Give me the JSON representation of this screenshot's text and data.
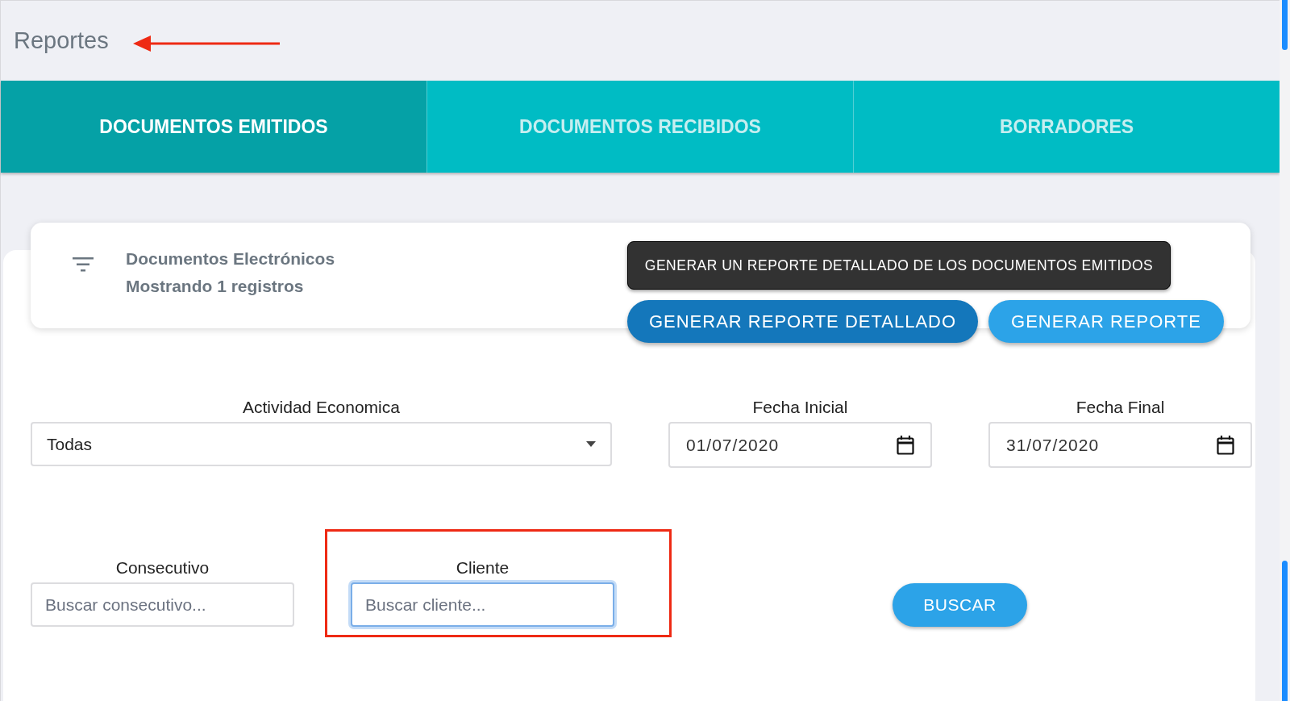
{
  "page_title": "Reportes",
  "tabs": [
    {
      "label": "DOCUMENTOS EMITIDOS",
      "selected": true
    },
    {
      "label": "DOCUMENTOS RECIBIDOS",
      "selected": false
    },
    {
      "label": "BORRADORES",
      "selected": false
    }
  ],
  "summary_card": {
    "title": "Documentos Electrónicos",
    "subtitle": "Mostrando 1 registros"
  },
  "tooltip": "GENERAR UN REPORTE DETALLADO DE LOS DOCUMENTOS EMITIDOS",
  "report_buttons": [
    {
      "label": "GENERAR REPORTE DETALLADO",
      "kind": "dark"
    },
    {
      "label": "GENERAR REPORTE",
      "kind": "light"
    }
  ],
  "filters": {
    "actividad": {
      "label": "Actividad Economica",
      "value": "Todas"
    },
    "fecha_inicial": {
      "label": "Fecha Inicial",
      "value": "01/07/2020"
    },
    "fecha_final": {
      "label": "Fecha Final",
      "value": "31/07/2020"
    },
    "consecutivo": {
      "label": "Consecutivo",
      "placeholder": "Buscar consecutivo...",
      "focused": false
    },
    "cliente": {
      "label": "Cliente",
      "placeholder": "Buscar cliente...",
      "focused": true
    }
  },
  "search_button": "BUSCAR"
}
